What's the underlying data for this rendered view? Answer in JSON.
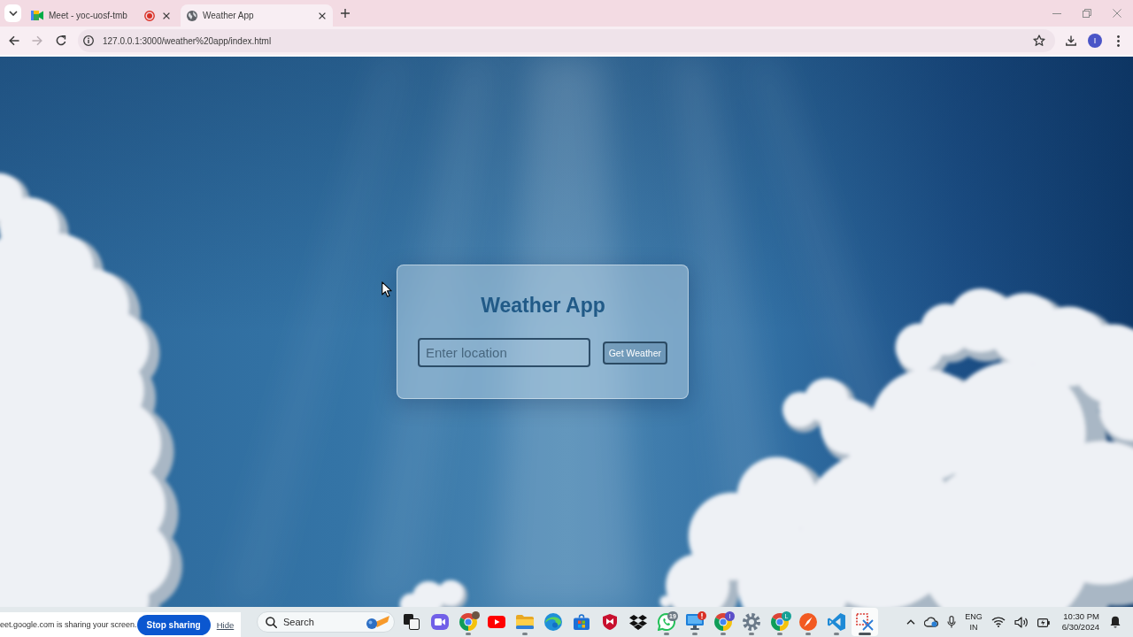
{
  "browser": {
    "tabs": [
      {
        "title": "Meet - yoc-uosf-tmb",
        "selected": false,
        "recording": true
      },
      {
        "title": "Weather App",
        "selected": true,
        "recording": false
      }
    ],
    "toolbar": {
      "back": {
        "disabled": false
      },
      "forward": {
        "disabled": true
      },
      "url": "127.0.0.1:3000/weather%20app/index.html",
      "profile_initial": "I"
    }
  },
  "page": {
    "title": "Weather App",
    "location_field": {
      "placeholder": "Enter location"
    },
    "submit_button": "Get Weather"
  },
  "screen_share": {
    "message": "eet.google.com is sharing your screen.",
    "stop_button": "Stop sharing",
    "hide_link": "Hide"
  },
  "taskbar": {
    "search": {
      "placeholder": "Search"
    },
    "apps": [
      {
        "running": false,
        "selected": false
      },
      {
        "running": false,
        "selected": false
      },
      {
        "running": true,
        "selected": false,
        "badge": {
          "kind": "photo"
        }
      },
      {
        "running": false,
        "selected": false
      },
      {
        "running": true,
        "selected": false
      },
      {
        "running": false,
        "selected": false
      },
      {
        "running": false,
        "selected": false
      },
      {
        "running": false,
        "selected": false
      },
      {
        "running": false,
        "selected": false
      },
      {
        "running": true,
        "selected": false,
        "badge": {
          "kind": "count",
          "text": "19"
        }
      },
      {
        "running": true,
        "selected": false,
        "badge": {
          "kind": "alert"
        }
      },
      {
        "running": true,
        "selected": false,
        "badge": {
          "kind": "letter",
          "text": "I",
          "color": "#5b4fc8"
        }
      },
      {
        "running": true,
        "selected": false
      },
      {
        "running": true,
        "selected": false,
        "badge": {
          "kind": "letter",
          "text": "L",
          "color": "#15a196"
        }
      },
      {
        "running": true,
        "selected": false
      },
      {
        "running": true,
        "selected": false
      },
      {
        "running": true,
        "selected": true
      }
    ],
    "tray": {
      "language": "ENG",
      "region": "IN",
      "time": "10:30 PM",
      "date": "6/30/2024"
    }
  }
}
